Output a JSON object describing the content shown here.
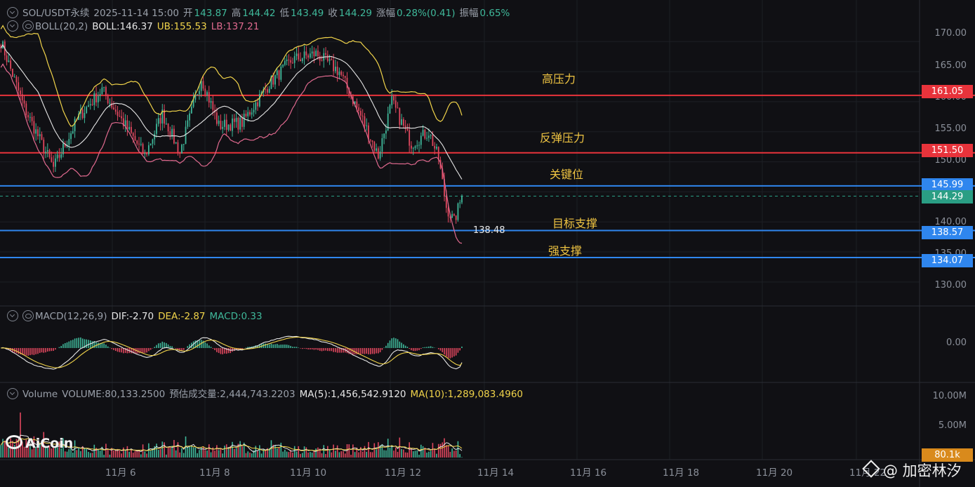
{
  "header": {
    "symbol": "SOL/USDT永续",
    "datetime": "2025-11-14 15:00",
    "open_label": "开",
    "open": "143.87",
    "high_label": "高",
    "high": "144.42",
    "low_label": "低",
    "low": "143.49",
    "close_label": "收",
    "close": "144.29",
    "change_label": "涨幅",
    "change": "0.28%(0.41)",
    "amplitude_label": "振幅",
    "amplitude": "0.65%"
  },
  "boll": {
    "title": "BOLL(20,2)",
    "mid": "BOLL:146.37",
    "ub": "UB:155.53",
    "lb": "LB:137.21"
  },
  "macd": {
    "title": "MACD(12,26,9)",
    "dif": "DIF:-2.70",
    "dea": "DEA:-2.87",
    "macd": "MACD:0.33"
  },
  "volume": {
    "title": "Volume",
    "volume": "VOLUME:80,133.2500",
    "forecast": "预估成交量:2,444,743.2203",
    "ma5": "MA(5):1,456,542.9120",
    "ma10": "MA(10):1,289,083.4960"
  },
  "annotations": {
    "zones": [
      "高压力",
      "反弹压力",
      "关键位",
      "目标支撑",
      "强支撑"
    ],
    "min_label": "138.48"
  },
  "price_tags": [
    "161.05",
    "151.50",
    "145.99",
    "144.29",
    "138.57",
    "134.07"
  ],
  "price_ticks": [
    "170.00",
    "165.00",
    "160.00",
    "155.00",
    "150.00",
    "140.00",
    "135.00",
    "130.00"
  ],
  "macd_ticks": [
    "0.00"
  ],
  "volume_ticks": [
    "10.00M",
    "5.00M"
  ],
  "volume_tag": "80.1k",
  "date_ticks": [
    "11月 6",
    "11月 8",
    "11月 10",
    "11月 12",
    "11月 14",
    "11月 16",
    "11月 18",
    "11月 20",
    "11月 22"
  ],
  "brand": "AiCoin",
  "watermark": "@ 加密林汐",
  "colors": {
    "up": "#3fb89a",
    "down": "#e0475e",
    "resistance": "#e8333b",
    "support": "#2f86ee",
    "boll_ub": "#f0d34a",
    "boll_mid": "#e6e6e6",
    "boll_lb": "#e06a8f",
    "zone_text": "#f0c542",
    "volume_tag": "#d98a1c"
  },
  "chart_data": {
    "type": "candlestick",
    "price_axis": {
      "ylim": [
        127.3,
        174.0
      ],
      "ticks": [
        130,
        135,
        140,
        145,
        150,
        155,
        160,
        165,
        170
      ]
    },
    "x_axis": {
      "start": "2025-11-04 18:00",
      "interval": "1h",
      "labels": [
        "11月 6",
        "11月 8",
        "11月 10",
        "11月 12",
        "11月 14",
        "11月 16",
        "11月 18",
        "11月 20",
        "11月 22"
      ]
    },
    "horizontal_levels": [
      {
        "value": 161.05,
        "label": "高压力",
        "color": "#e8333b"
      },
      {
        "value": 151.5,
        "label": "反弹压力",
        "color": "#e8333b"
      },
      {
        "value": 145.99,
        "label": "关键位",
        "color": "#2f86ee"
      },
      {
        "value": 138.57,
        "label": "目标支撑",
        "color": "#2f86ee"
      },
      {
        "value": 134.07,
        "label": "强支撑",
        "color": "#2f86ee"
      }
    ],
    "last_price": 144.29,
    "period_low": 138.48,
    "close_keypoints": [
      {
        "t": "2025-11-04 18:00",
        "price": 170.0
      },
      {
        "t": "2025-11-05 06:00",
        "price": 159.0
      },
      {
        "t": "2025-11-05 21:00",
        "price": 149.0
      },
      {
        "t": "2025-11-06 10:00",
        "price": 157.5
      },
      {
        "t": "2025-11-06 22:00",
        "price": 162.0
      },
      {
        "t": "2025-11-07 10:00",
        "price": 156.0
      },
      {
        "t": "2025-11-07 20:00",
        "price": 151.0
      },
      {
        "t": "2025-11-08 05:00",
        "price": 158.0
      },
      {
        "t": "2025-11-08 14:00",
        "price": 151.5
      },
      {
        "t": "2025-11-09 01:00",
        "price": 164.0
      },
      {
        "t": "2025-11-09 10:00",
        "price": 156.0
      },
      {
        "t": "2025-11-09 22:00",
        "price": 156.5
      },
      {
        "t": "2025-11-10 12:00",
        "price": 163.0
      },
      {
        "t": "2025-11-11 00:00",
        "price": 167.0
      },
      {
        "t": "2025-11-11 12:00",
        "price": 168.0
      },
      {
        "t": "2025-11-12 00:00",
        "price": 165.0
      },
      {
        "t": "2025-11-12 12:00",
        "price": 157.0
      },
      {
        "t": "2025-11-12 20:00",
        "price": 151.0
      },
      {
        "t": "2025-11-13 03:00",
        "price": 160.0
      },
      {
        "t": "2025-11-13 13:00",
        "price": 153.0
      },
      {
        "t": "2025-11-13 22:00",
        "price": 155.0
      },
      {
        "t": "2025-11-14 03:00",
        "price": 150.5
      },
      {
        "t": "2025-11-14 07:00",
        "price": 142.5
      },
      {
        "t": "2025-11-14 11:00",
        "price": 140.0
      },
      {
        "t": "2025-11-14 15:00",
        "price": 144.29
      }
    ],
    "macd_axis": {
      "ylim": [
        -5.8,
        5.0
      ],
      "ticks": [
        0
      ]
    },
    "volume_axis": {
      "ylim": [
        0,
        11500000
      ],
      "ticks": [
        5000000,
        10000000
      ]
    }
  }
}
